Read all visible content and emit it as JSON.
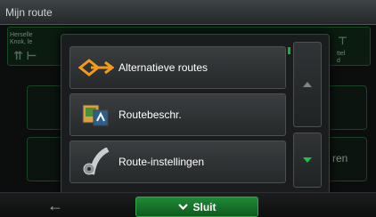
{
  "title_bar": {
    "title": "Mijn route"
  },
  "background": {
    "address_line1": "Herselle",
    "address_line2": "Knok, le",
    "right_snippet1": "ttel",
    "right_snippet2": "d",
    "card_text": "ren"
  },
  "menu": {
    "items": [
      {
        "label": "Alternatieve routes",
        "icon": "alternative-routes-icon"
      },
      {
        "label": "Routebeschr.",
        "icon": "route-description-icon"
      },
      {
        "label": "Route-instellingen",
        "icon": "route-settings-icon"
      }
    ]
  },
  "bottom_bar": {
    "close_label": "Sluit"
  },
  "colors": {
    "accent": "#1f8a35",
    "scroll_marker": "#1cae3d"
  }
}
